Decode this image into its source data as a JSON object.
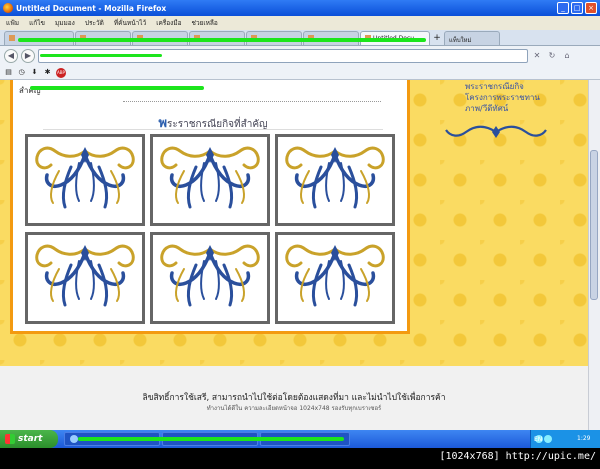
{
  "window": {
    "title": "Untitled Document - Mozilla Firefox"
  },
  "menubar": {
    "items": [
      "แฟ้ม",
      "แก้ไข",
      "มุมมอง",
      "ประวัติ",
      "ที่คั่นหน้าไว้",
      "เครื่องมือ",
      "ช่วยเหลือ"
    ]
  },
  "tabs": {
    "active_label": "Untitled Docu...",
    "new_tab_label": "+",
    "extra_label": "แท็บใหม่"
  },
  "page": {
    "top_text": "สำคัญ",
    "section_title_first": "พ",
    "section_title_rest": "ระราชกรณียกิจที่สำคัญ",
    "sidebar_links": [
      "พระราชกรณียกิจ",
      "โครงการพระราชทาน",
      "ภาพ/วีดีทัศน์"
    ],
    "footer_line1": "ลิขสิทธิ์การใช้เสรี, สามารถนำไปใช้ต่อโดยต้องแสดงที่มา และไม่นำไปใช้เพื่อการค้า",
    "footer_line2": "ทำงานได้ดีใน ความละเอียดหน้าจอ 1024x748 รองรับทุกเบราเซอร์"
  },
  "taskbar": {
    "start_label": "start",
    "lang": "EN",
    "clock": "1:29"
  },
  "watermark": {
    "text": "[1024x768] http://upic.me/"
  },
  "colors": {
    "accent_orange": "#f39a10",
    "page_gold": "#fadb62",
    "title_blue": "#2c5fae"
  }
}
